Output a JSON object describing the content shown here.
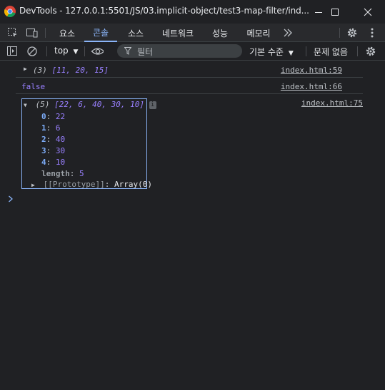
{
  "window": {
    "title": "DevTools - 127.0.0.1:5501/JS/03.implicit-object/test3-map-filter/ind..."
  },
  "tabs": [
    {
      "label": "요소",
      "active": false
    },
    {
      "label": "콘솔",
      "active": true
    },
    {
      "label": "소스",
      "active": false
    },
    {
      "label": "네트워크",
      "active": false
    },
    {
      "label": "성능",
      "active": false
    },
    {
      "label": "메모리",
      "active": false
    }
  ],
  "toolbar": {
    "context": "top",
    "filter_placeholder": "필터",
    "levels": "기본 수준",
    "issues": "문제 없음"
  },
  "console": {
    "entries": [
      {
        "preview_count": "(3)",
        "preview_values": "[11, 20, 15]",
        "source": "index.html:59"
      },
      {
        "value": "false",
        "source": "index.html:66"
      },
      {
        "preview_count": "(5)",
        "preview_values": "[22, 6, 40, 30, 10]",
        "info": "i",
        "source": "index.html:75",
        "items": [
          {
            "key": "0",
            "value": "22"
          },
          {
            "key": "1",
            "value": "6"
          },
          {
            "key": "2",
            "value": "40"
          },
          {
            "key": "3",
            "value": "30"
          },
          {
            "key": "4",
            "value": "10"
          }
        ],
        "length_key": "length",
        "length_value": "5",
        "prototype_key": "[[Prototype]]",
        "prototype_value": "Array(0)"
      }
    ]
  },
  "colors": {
    "accent": "#8ab4f8",
    "number": "#9980ff",
    "background": "#202124"
  }
}
